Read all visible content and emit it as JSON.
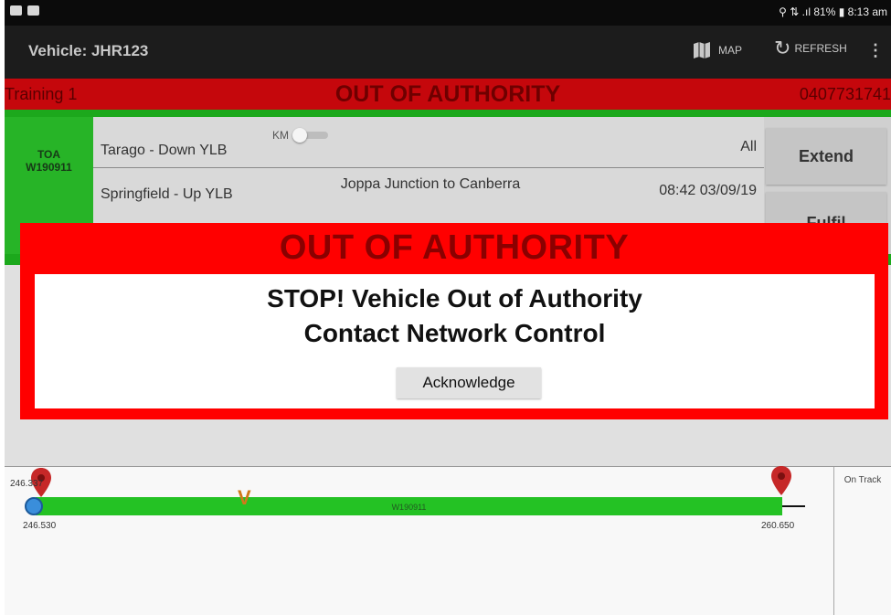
{
  "statusbar": {
    "right_text": "⚲ ⇅ .ıl 81% ▮ 8:13 am"
  },
  "appbar": {
    "vehicle_label": "Vehicle: JHR123",
    "map_label": "MAP",
    "refresh_label": "REFRESH",
    "more_icon": "⋮"
  },
  "banner": {
    "training": "Training 1",
    "title": "OUT OF AUTHORITY",
    "phone": "0407731741"
  },
  "authority": {
    "toa_label": "TOA",
    "toa_id": "W190911",
    "km_label": "KM",
    "row1_left": "Tarago - Down YLB",
    "row1_right": "All",
    "row2_left": "Springfield - Up YLB",
    "row2_mid": "Joppa Junction to Canberra",
    "row2_right": "08:42 03/09/19",
    "extend_label": "Extend",
    "fulfil_label": "Fulfil"
  },
  "track": {
    "label": "W190911",
    "top_left_km": "246.337",
    "start_km": "246.530",
    "end_km": "260.650",
    "vehicle_marker": "V",
    "on_track_label": "On Track"
  },
  "modal": {
    "title": "OUT OF AUTHORITY",
    "line1": "STOP! Vehicle Out of Authority",
    "line2": "Contact Network Control",
    "button": "Acknowledge"
  },
  "colors": {
    "alert_red": "#ff0000",
    "banner_red": "#c5070c",
    "authority_green": "#1ca81c",
    "track_green": "#24c224"
  }
}
